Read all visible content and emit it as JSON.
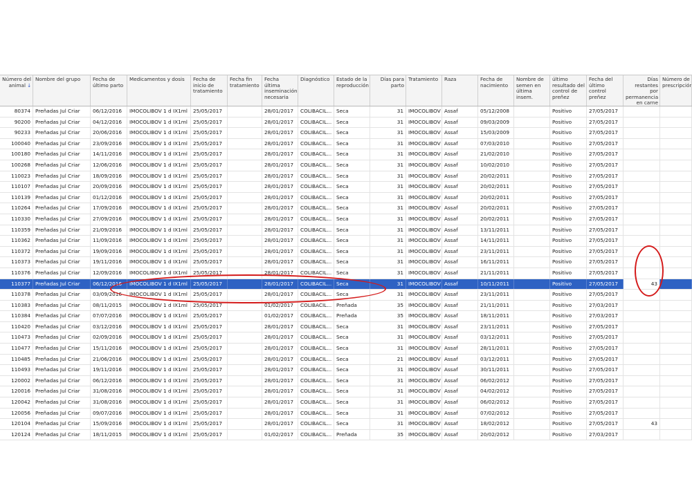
{
  "columns": [
    {
      "label": "Número del animal",
      "sort": "↓",
      "align": "r"
    },
    {
      "label": "Nombre del grupo",
      "align": "l"
    },
    {
      "label": "Fecha de último parto",
      "align": "l"
    },
    {
      "label": "Medicamentos y dosis",
      "align": "l"
    },
    {
      "label": "Fecha de inicio de tratamiento",
      "align": "l"
    },
    {
      "label": "Fecha fin tratamiento",
      "align": "l"
    },
    {
      "label": "Fecha última inseminación necesaria",
      "align": "l"
    },
    {
      "label": "Diagnóstico",
      "align": "l"
    },
    {
      "label": "Estado de la reproducción",
      "align": "l"
    },
    {
      "label": "Días para parto",
      "align": "r"
    },
    {
      "label": "Tratamiento",
      "align": "l"
    },
    {
      "label": "Raza",
      "align": "l"
    },
    {
      "label": "Fecha de nacimiento",
      "align": "l"
    },
    {
      "label": "Nombre de semen en última insem.",
      "align": "l"
    },
    {
      "label": "último resultado del control de preñez",
      "align": "l"
    },
    {
      "label": "Fecha del último control preñez",
      "align": "l"
    },
    {
      "label": "Días restantes por permanencia en carne",
      "align": "r"
    },
    {
      "label": "Número de prescripción",
      "align": "l"
    }
  ],
  "rows": [
    [
      "80374",
      "Preñadas Jul Criar",
      "06/12/2016",
      "IMOCOLIBOV 1 d IX1ml",
      "25/05/2017",
      "",
      "28/01/2017",
      "COLIBACIL...",
      "Seca",
      "31",
      "IMOCOLIBOV",
      "Assaf",
      "05/12/2008",
      "",
      "Positivo",
      "27/05/2017",
      "",
      ""
    ],
    [
      "90200",
      "Preñadas Jul Criar",
      "04/12/2016",
      "IMOCOLIBOV 1 d IX1ml",
      "25/05/2017",
      "",
      "28/01/2017",
      "COLIBACIL...",
      "Seca",
      "31",
      "IMOCOLIBOV",
      "Assaf",
      "09/03/2009",
      "",
      "Positivo",
      "27/05/2017",
      "",
      ""
    ],
    [
      "90233",
      "Preñadas Jul Criar",
      "20/06/2016",
      "IMOCOLIBOV 1 d IX1ml",
      "25/05/2017",
      "",
      "28/01/2017",
      "COLIBACIL...",
      "Seca",
      "31",
      "IMOCOLIBOV",
      "Assaf",
      "15/03/2009",
      "",
      "Positivo",
      "27/05/2017",
      "",
      ""
    ],
    [
      "100040",
      "Preñadas Jul Criar",
      "23/09/2016",
      "IMOCOLIBOV 1 d IX1ml",
      "25/05/2017",
      "",
      "28/01/2017",
      "COLIBACIL...",
      "Seca",
      "31",
      "IMOCOLIBOV",
      "Assaf",
      "07/03/2010",
      "",
      "Positivo",
      "27/05/2017",
      "",
      ""
    ],
    [
      "100180",
      "Preñadas Jul Criar",
      "14/11/2016",
      "IMOCOLIBOV 1 d IX1ml",
      "25/05/2017",
      "",
      "28/01/2017",
      "COLIBACIL...",
      "Seca",
      "31",
      "IMOCOLIBOV",
      "Assaf",
      "21/02/2010",
      "",
      "Positivo",
      "27/05/2017",
      "",
      ""
    ],
    [
      "100268",
      "Preñadas Jul Criar",
      "12/06/2016",
      "IMOCOLIBOV 1 d IX1ml",
      "25/05/2017",
      "",
      "28/01/2017",
      "COLIBACIL...",
      "Seca",
      "31",
      "IMOCOLIBOV",
      "Assaf",
      "10/02/2010",
      "",
      "Positivo",
      "27/05/2017",
      "",
      ""
    ],
    [
      "110023",
      "Preñadas Jul Criar",
      "18/09/2016",
      "IMOCOLIBOV 1 d IX1ml",
      "25/05/2017",
      "",
      "28/01/2017",
      "COLIBACIL...",
      "Seca",
      "31",
      "IMOCOLIBOV",
      "Assaf",
      "20/02/2011",
      "",
      "Positivo",
      "27/05/2017",
      "",
      ""
    ],
    [
      "110107",
      "Preñadas Jul Criar",
      "20/09/2016",
      "IMOCOLIBOV 1 d IX1ml",
      "25/05/2017",
      "",
      "28/01/2017",
      "COLIBACIL...",
      "Seca",
      "31",
      "IMOCOLIBOV",
      "Assaf",
      "20/02/2011",
      "",
      "Positivo",
      "27/05/2017",
      "",
      ""
    ],
    [
      "110139",
      "Preñadas Jul Criar",
      "01/12/2016",
      "IMOCOLIBOV 1 d IX1ml",
      "25/05/2017",
      "",
      "28/01/2017",
      "COLIBACIL...",
      "Seca",
      "31",
      "IMOCOLIBOV",
      "Assaf",
      "20/02/2011",
      "",
      "Positivo",
      "27/05/2017",
      "",
      ""
    ],
    [
      "110264",
      "Preñadas Jul Criar",
      "17/09/2016",
      "IMOCOLIBOV 1 d IX1ml",
      "25/05/2017",
      "",
      "28/01/2017",
      "COLIBACIL...",
      "Seca",
      "31",
      "IMOCOLIBOV",
      "Assaf",
      "20/02/2011",
      "",
      "Positivo",
      "27/05/2017",
      "",
      ""
    ],
    [
      "110330",
      "Preñadas Jul Criar",
      "27/09/2016",
      "IMOCOLIBOV 1 d IX1ml",
      "25/05/2017",
      "",
      "28/01/2017",
      "COLIBACIL...",
      "Seca",
      "31",
      "IMOCOLIBOV",
      "Assaf",
      "20/02/2011",
      "",
      "Positivo",
      "27/05/2017",
      "",
      ""
    ],
    [
      "110359",
      "Preñadas Jul Criar",
      "21/09/2016",
      "IMOCOLIBOV 1 d IX1ml",
      "25/05/2017",
      "",
      "28/01/2017",
      "COLIBACIL...",
      "Seca",
      "31",
      "IMOCOLIBOV",
      "Assaf",
      "13/11/2011",
      "",
      "Positivo",
      "27/05/2017",
      "",
      ""
    ],
    [
      "110362",
      "Preñadas Jul Criar",
      "11/09/2016",
      "IMOCOLIBOV 1 d IX1ml",
      "25/05/2017",
      "",
      "28/01/2017",
      "COLIBACIL...",
      "Seca",
      "31",
      "IMOCOLIBOV",
      "Assaf",
      "14/11/2011",
      "",
      "Positivo",
      "27/05/2017",
      "",
      ""
    ],
    [
      "110372",
      "Preñadas Jul Criar",
      "19/09/2016",
      "IMOCOLIBOV 1 d IX1ml",
      "25/05/2017",
      "",
      "28/01/2017",
      "COLIBACIL...",
      "Seca",
      "31",
      "IMOCOLIBOV",
      "Assaf",
      "23/11/2011",
      "",
      "Positivo",
      "27/05/2017",
      "",
      ""
    ],
    [
      "110373",
      "Preñadas Jul Criar",
      "19/11/2016",
      "IMOCOLIBOV 1 d IX1ml",
      "25/05/2017",
      "",
      "28/01/2017",
      "COLIBACIL...",
      "Seca",
      "31",
      "IMOCOLIBOV",
      "Assaf",
      "16/11/2011",
      "",
      "Positivo",
      "27/05/2017",
      "",
      ""
    ],
    [
      "110376",
      "Preñadas Jul Criar",
      "12/09/2016",
      "IMOCOLIBOV 1 d IX1ml",
      "25/05/2017",
      "",
      "28/01/2017",
      "COLIBACIL...",
      "Seca",
      "31",
      "IMOCOLIBOV",
      "Assaf",
      "21/11/2011",
      "",
      "Positivo",
      "27/05/2017",
      "",
      ""
    ],
    [
      "110377",
      "Preñadas Jul Criar",
      "06/12/2016",
      "IMOCOLIBOV 1 d IX1ml",
      "25/05/2017",
      "",
      "28/01/2017",
      "COLIBACIL...",
      "Seca",
      "31",
      "IMOCOLIBOV",
      "Assaf",
      "10/11/2011",
      "",
      "Positivo",
      "27/05/2017",
      "43",
      ""
    ],
    [
      "110378",
      "Preñadas Jul Criar",
      "03/09/2016",
      "IMOCOLIBOV 1 d IX1ml",
      "25/05/2017",
      "",
      "28/01/2017",
      "COLIBACIL...",
      "Seca",
      "31",
      "IMOCOLIBOV",
      "Assaf",
      "23/11/2011",
      "",
      "Positivo",
      "27/05/2017",
      "",
      ""
    ],
    [
      "110383",
      "Preñadas Jul Criar",
      "08/11/2015",
      "IMOCOLIBOV 1 d IX1ml",
      "25/05/2017",
      "",
      "01/02/2017",
      "COLIBACIL...",
      "Preñada",
      "35",
      "IMOCOLIBOV",
      "Assaf",
      "21/11/2011",
      "",
      "Positivo",
      "27/03/2017",
      "",
      ""
    ],
    [
      "110384",
      "Preñadas Jul Criar",
      "07/07/2016",
      "IMOCOLIBOV 1 d IX1ml",
      "25/05/2017",
      "",
      "01/02/2017",
      "COLIBACIL...",
      "Preñada",
      "35",
      "IMOCOLIBOV",
      "Assaf",
      "18/11/2011",
      "",
      "Positivo",
      "27/03/2017",
      "",
      ""
    ],
    [
      "110420",
      "Preñadas Jul Criar",
      "03/12/2016",
      "IMOCOLIBOV 1 d IX1ml",
      "25/05/2017",
      "",
      "28/01/2017",
      "COLIBACIL...",
      "Seca",
      "31",
      "IMOCOLIBOV",
      "Assaf",
      "23/11/2011",
      "",
      "Positivo",
      "27/05/2017",
      "",
      ""
    ],
    [
      "110473",
      "Preñadas Jul Criar",
      "02/09/2016",
      "IMOCOLIBOV 1 d IX1ml",
      "25/05/2017",
      "",
      "28/01/2017",
      "COLIBACIL...",
      "Seca",
      "31",
      "IMOCOLIBOV",
      "Assaf",
      "03/12/2011",
      "",
      "Positivo",
      "27/05/2017",
      "",
      ""
    ],
    [
      "110477",
      "Preñadas Jul Criar",
      "15/11/2016",
      "IMOCOLIBOV 1 d IX1ml",
      "25/05/2017",
      "",
      "28/01/2017",
      "COLIBACIL...",
      "Seca",
      "31",
      "IMOCOLIBOV",
      "Assaf",
      "28/11/2011",
      "",
      "Positivo",
      "27/05/2017",
      "",
      ""
    ],
    [
      "110485",
      "Preñadas Jul Criar",
      "21/06/2016",
      "IMOCOLIBOV 1 d IX1ml",
      "25/05/2017",
      "",
      "28/01/2017",
      "COLIBACIL...",
      "Seca",
      "21",
      "IMOCOLIBOV",
      "Assaf",
      "03/12/2011",
      "",
      "Positivo",
      "27/05/2017",
      "",
      ""
    ],
    [
      "110493",
      "Preñadas Jul Criar",
      "19/11/2016",
      "IMOCOLIBOV 1 d IX1ml",
      "25/05/2017",
      "",
      "28/01/2017",
      "COLIBACIL...",
      "Seca",
      "31",
      "IMOCOLIBOV",
      "Assaf",
      "30/11/2011",
      "",
      "Positivo",
      "27/05/2017",
      "",
      ""
    ],
    [
      "120002",
      "Preñadas Jul Criar",
      "06/12/2016",
      "IMOCOLIBOV 1 d IX1ml",
      "25/05/2017",
      "",
      "28/01/2017",
      "COLIBACIL...",
      "Seca",
      "31",
      "IMOCOLIBOV",
      "Assaf",
      "06/02/2012",
      "",
      "Positivo",
      "27/05/2017",
      "",
      ""
    ],
    [
      "120016",
      "Preñadas Jul Criar",
      "31/08/2016",
      "IMOCOLIBOV 1 d IX1ml",
      "25/05/2017",
      "",
      "28/01/2017",
      "COLIBACIL...",
      "Seca",
      "31",
      "IMOCOLIBOV",
      "Assaf",
      "04/02/2012",
      "",
      "Positivo",
      "27/05/2017",
      "",
      ""
    ],
    [
      "120042",
      "Preñadas Jul Criar",
      "31/08/2016",
      "IMOCOLIBOV 1 d IX1ml",
      "25/05/2017",
      "",
      "28/01/2017",
      "COLIBACIL...",
      "Seca",
      "31",
      "IMOCOLIBOV",
      "Assaf",
      "06/02/2012",
      "",
      "Positivo",
      "27/05/2017",
      "",
      ""
    ],
    [
      "120056",
      "Preñadas Jul Criar",
      "09/07/2016",
      "IMOCOLIBOV 1 d IX1ml",
      "25/05/2017",
      "",
      "28/01/2017",
      "COLIBACIL...",
      "Seca",
      "31",
      "IMOCOLIBOV",
      "Assaf",
      "07/02/2012",
      "",
      "Positivo",
      "27/05/2017",
      "",
      ""
    ],
    [
      "120104",
      "Preñadas Jul Criar",
      "15/09/2016",
      "IMOCOLIBOV 1 d IX1ml",
      "25/05/2017",
      "",
      "28/01/2017",
      "COLIBACIL...",
      "Seca",
      "31",
      "IMOCOLIBOV",
      "Assaf",
      "18/02/2012",
      "",
      "Positivo",
      "27/05/2017",
      "43",
      ""
    ],
    [
      "120124",
      "Preñadas Jul Criar",
      "18/11/2015",
      "IMOCOLIBOV 1 d IX1ml",
      "25/05/2017",
      "",
      "01/02/2017",
      "COLIBACIL...",
      "Preñada",
      "35",
      "IMOCOLIBOV",
      "Assaf",
      "20/02/2012",
      "",
      "Positivo",
      "27/03/2017",
      "",
      ""
    ]
  ],
  "selected_row_index": 16,
  "colors": {
    "selection": "#2e62c3",
    "annotation": "#d41a1a",
    "sort_arrow": "#2b55c9"
  },
  "icons": {
    "sort_indicator": "arrow-down-icon"
  }
}
